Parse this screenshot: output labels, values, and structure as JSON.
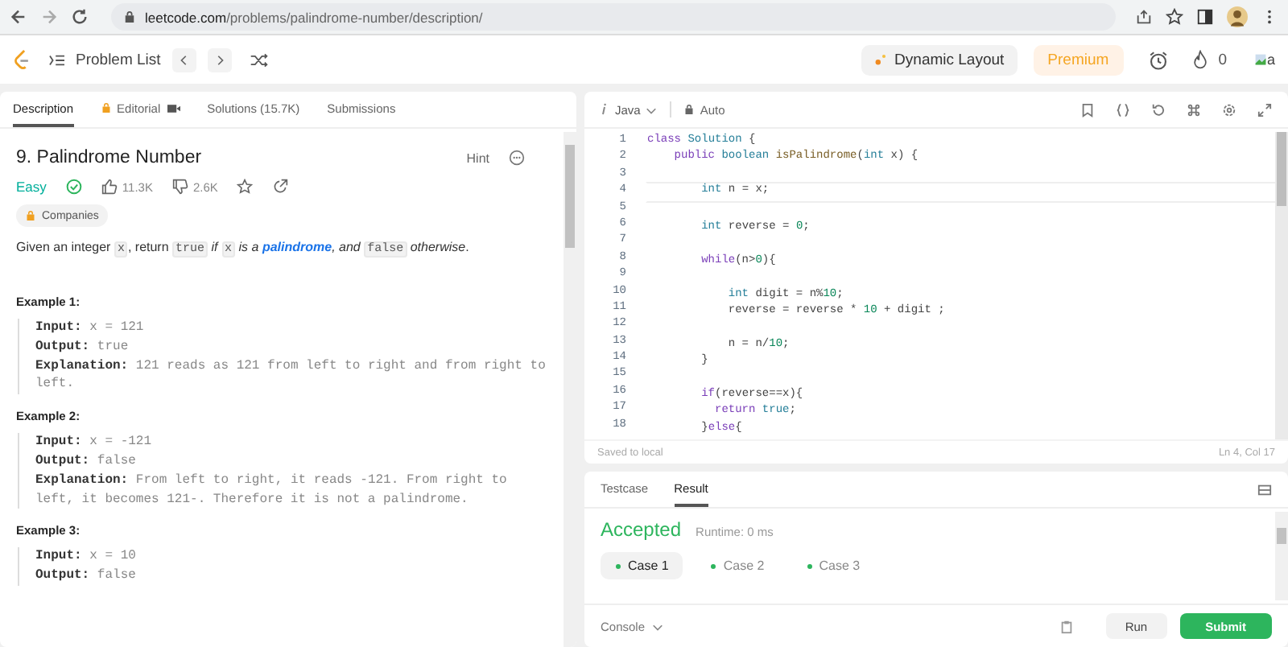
{
  "browser": {
    "url_host": "leetcode.com",
    "url_path": "/problems/palindrome-number/description/"
  },
  "nav": {
    "problem_list": "Problem List",
    "dynamic_layout": "Dynamic Layout",
    "premium": "Premium",
    "streak": "0",
    "avatar_alt": "a"
  },
  "left_tabs": [
    {
      "label": "Description",
      "selected": true,
      "kind": "plain"
    },
    {
      "label": "Editorial",
      "selected": false,
      "kind": "locked"
    },
    {
      "label": "Solutions (15.7K)",
      "selected": false,
      "kind": "plain"
    },
    {
      "label": "Submissions",
      "selected": false,
      "kind": "plain"
    }
  ],
  "problem": {
    "title": "9. Palindrome Number",
    "hint": "Hint",
    "difficulty": "Easy",
    "solved": true,
    "likes": "11.3K",
    "dislikes": "2.6K",
    "companies": "Companies",
    "statement": [
      {
        "kind": "text",
        "text": "Given an integer "
      },
      {
        "kind": "code",
        "text": "x"
      },
      {
        "kind": "text",
        "text": ", return "
      },
      {
        "kind": "code",
        "text": "true"
      },
      {
        "kind": "text",
        "text": " *if* "
      },
      {
        "kind": "code",
        "text": "x"
      },
      {
        "kind": "text",
        "text": " *is a* "
      },
      {
        "kind": "link",
        "text": "palindrome"
      },
      {
        "kind": "text",
        "text": "*, and* "
      },
      {
        "kind": "code",
        "text": "false"
      },
      {
        "kind": "text",
        "text": " *otherwise*."
      }
    ],
    "examples": [
      {
        "title": "Example 1:",
        "lines": [
          {
            "label": "Input:",
            "value": "x = 121"
          },
          {
            "label": "Output:",
            "value": "true"
          },
          {
            "label": "Explanation:",
            "value": "121 reads as 121 from left to right and from right to left."
          }
        ]
      },
      {
        "title": "Example 2:",
        "lines": [
          {
            "label": "Input:",
            "value": "x = -121"
          },
          {
            "label": "Output:",
            "value": "false"
          },
          {
            "label": "Explanation:",
            "value": "From left to right, it reads -121. From right to left, it becomes 121-. Therefore it is not a palindrome."
          }
        ]
      },
      {
        "title": "Example 3:",
        "lines": [
          {
            "label": "Input:",
            "value": "x = 10"
          },
          {
            "label": "Output:",
            "value": "false"
          }
        ]
      }
    ]
  },
  "editor": {
    "language": "Java",
    "mode": "Auto",
    "status_left": "Saved to local",
    "status_right": "Ln 4, Col 17",
    "lines": [
      {
        "number": "1",
        "tokens": [
          {
            "kind": "keyword",
            "text": "class "
          },
          {
            "kind": "type",
            "text": "Solution"
          },
          {
            "kind": "plain",
            "text": " {"
          }
        ]
      },
      {
        "number": "2",
        "tokens": [
          {
            "kind": "keyword",
            "text": "    public "
          },
          {
            "kind": "type",
            "text": "boolean "
          },
          {
            "kind": "function",
            "text": "isPalindrome"
          },
          {
            "kind": "plain",
            "text": "("
          },
          {
            "kind": "type",
            "text": "int"
          },
          {
            "kind": "plain",
            "text": " x) {"
          }
        ]
      },
      {
        "number": "3"
      },
      {
        "number": "4",
        "tokens": [
          {
            "kind": "type",
            "text": "        int"
          },
          {
            "kind": "plain",
            "text": " n = x;"
          }
        ]
      },
      {
        "number": "5"
      },
      {
        "number": "6",
        "tokens": [
          {
            "kind": "type",
            "text": "        int"
          },
          {
            "kind": "plain",
            "text": " reverse = "
          },
          {
            "kind": "number",
            "text": "0"
          },
          {
            "kind": "plain",
            "text": ";"
          }
        ]
      },
      {
        "number": "7"
      },
      {
        "number": "8",
        "tokens": [
          {
            "kind": "keyword",
            "text": "        while"
          },
          {
            "kind": "plain",
            "text": "(n>"
          },
          {
            "kind": "number",
            "text": "0"
          },
          {
            "kind": "plain",
            "text": "){"
          }
        ]
      },
      {
        "number": "9"
      },
      {
        "number": "10",
        "tokens": [
          {
            "kind": "type",
            "text": "            int"
          },
          {
            "kind": "plain",
            "text": " digit = n%"
          },
          {
            "kind": "number",
            "text": "10"
          },
          {
            "kind": "plain",
            "text": ";"
          }
        ]
      },
      {
        "number": "11",
        "tokens": [
          {
            "kind": "plain",
            "text": "            reverse = reverse * "
          },
          {
            "kind": "number",
            "text": "10"
          },
          {
            "kind": "plain",
            "text": " + digit ;"
          }
        ]
      },
      {
        "number": "12"
      },
      {
        "number": "13",
        "tokens": [
          {
            "kind": "plain",
            "text": "            n = n/"
          },
          {
            "kind": "number",
            "text": "10"
          },
          {
            "kind": "plain",
            "text": ";"
          }
        ]
      },
      {
        "number": "14",
        "tokens": [
          {
            "kind": "plain",
            "text": "        }"
          }
        ]
      },
      {
        "number": "15"
      },
      {
        "number": "16",
        "tokens": [
          {
            "kind": "keyword",
            "text": "        if"
          },
          {
            "kind": "plain",
            "text": "(reverse==x){"
          }
        ]
      },
      {
        "number": "17",
        "tokens": [
          {
            "kind": "keyword",
            "text": "          return "
          },
          {
            "kind": "type",
            "text": "true"
          },
          {
            "kind": "plain",
            "text": ";"
          }
        ]
      },
      {
        "number": "18",
        "tokens": [
          {
            "kind": "plain",
            "text": "        }"
          },
          {
            "kind": "keyword",
            "text": "else"
          },
          {
            "kind": "plain",
            "text": "{"
          }
        ]
      }
    ]
  },
  "bottom_tabs": [
    {
      "label": "Testcase",
      "selected": false
    },
    {
      "label": "Result",
      "selected": true
    }
  ],
  "result": {
    "verdict": "Accepted",
    "runtime": "Runtime: 0 ms",
    "cases": [
      {
        "label": "Case 1",
        "selected": true
      },
      {
        "label": "Case 2",
        "selected": false
      },
      {
        "label": "Case 3",
        "selected": false
      }
    ]
  },
  "footer": {
    "console": "Console",
    "run": "Run",
    "submit": "Submit"
  }
}
